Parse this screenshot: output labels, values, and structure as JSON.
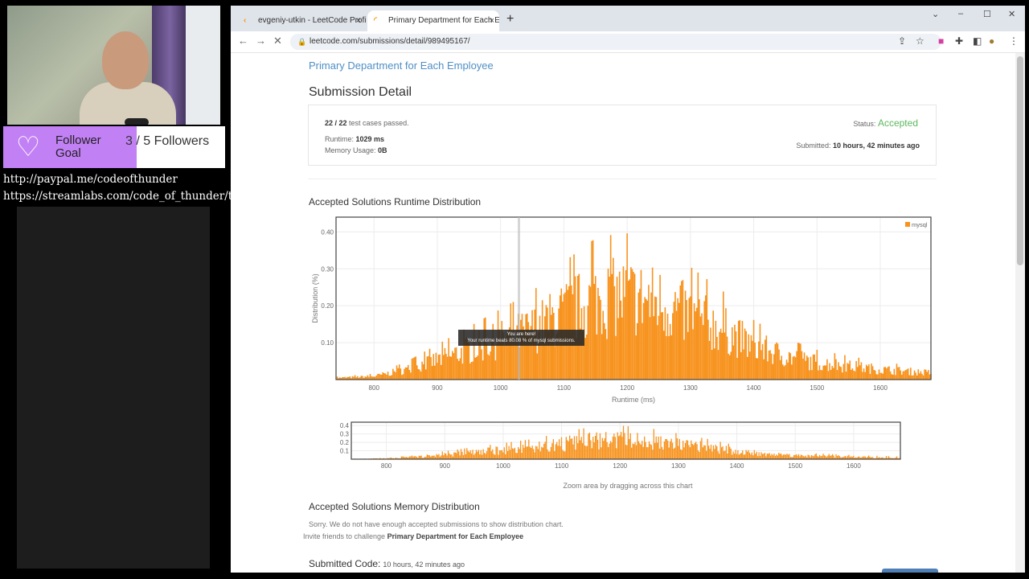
{
  "stream": {
    "follower_goal": {
      "label": "Follower Goal",
      "current": "3",
      "separator": "/",
      "target": "5 Followers",
      "progress": 0.6
    },
    "links": [
      "http://paypal.me/codeofthunder",
      "https://streamlabs.com/code_of_thunder/tip"
    ]
  },
  "browser": {
    "tabs": [
      {
        "label": "evgeniy-utkin - LeetCode Profile",
        "close": "×"
      },
      {
        "label": "Primary Department for Each Em",
        "close": "×"
      }
    ],
    "new_tab": "+",
    "window_controls": [
      "⌄",
      "–",
      "☐",
      "✕"
    ],
    "url": "leetcode.com/submissions/detail/989495167/"
  },
  "page": {
    "problem_title": "Primary Department for Each Employee",
    "heading": "Submission Detail",
    "summary": {
      "cases_count": "22 / 22",
      "cases_text": "test cases passed.",
      "runtime_label": "Runtime:",
      "runtime_value": "1029 ms",
      "memory_label": "Memory Usage:",
      "memory_value": "0B",
      "status_label": "Status:",
      "status_value": "Accepted",
      "submitted_label": "Submitted:",
      "submitted_value": "10 hours, 42 minutes ago"
    },
    "runtime_heading": "Accepted Solutions Runtime Distribution",
    "tooltip_line1": "You are here!",
    "tooltip_line2": "Your runtime beats 80.08 % of mysql submissions.",
    "zoom_hint": "Zoom area by dragging across this chart",
    "memory_heading": "Accepted Solutions Memory Distribution",
    "memory_sorry": "Sorry. We do not have enough accepted submissions to show distribution chart.",
    "invite_prefix": "Invite friends to challenge",
    "invite_problem": "Primary Department for Each Employee",
    "submitted_code_label": "Submitted Code:",
    "submitted_code_ago": "10 hours, 42 minutes ago"
  },
  "chart_data": [
    {
      "type": "bar",
      "title": "Accepted Solutions Runtime Distribution",
      "xlabel": "Runtime (ms)",
      "ylabel": "Distribution (%)",
      "xlim": [
        740,
        1680
      ],
      "ylim": [
        0,
        0.44
      ],
      "x_ticks": [
        800,
        900,
        1000,
        1100,
        1200,
        1300,
        1400,
        1500,
        1600
      ],
      "y_ticks": [
        0.1,
        0.2,
        0.3,
        0.4
      ],
      "legend": "top-right",
      "series": [
        {
          "name": "mysql",
          "color": "#f7931e"
        }
      ],
      "envelope": {
        "x": [
          740,
          800,
          850,
          900,
          950,
          1000,
          1050,
          1100,
          1150,
          1200,
          1250,
          1300,
          1350,
          1400,
          1450,
          1500,
          1550,
          1600,
          1680
        ],
        "y": [
          0.005,
          0.01,
          0.03,
          0.06,
          0.09,
          0.12,
          0.15,
          0.2,
          0.24,
          0.25,
          0.23,
          0.19,
          0.15,
          0.1,
          0.07,
          0.05,
          0.04,
          0.03,
          0.02
        ]
      },
      "marker_x": 1029
    },
    {
      "type": "bar",
      "title": "",
      "xlabel": "",
      "ylabel": "",
      "xlim": [
        740,
        1680
      ],
      "ylim": [
        0,
        0.44
      ],
      "x_ticks": [
        800,
        900,
        1000,
        1100,
        1200,
        1300,
        1400,
        1500,
        1600
      ],
      "y_ticks": [
        0.1,
        0.2,
        0.3,
        0.4
      ],
      "series": [
        {
          "name": "mysql",
          "color": "#f7931e"
        }
      ]
    }
  ]
}
